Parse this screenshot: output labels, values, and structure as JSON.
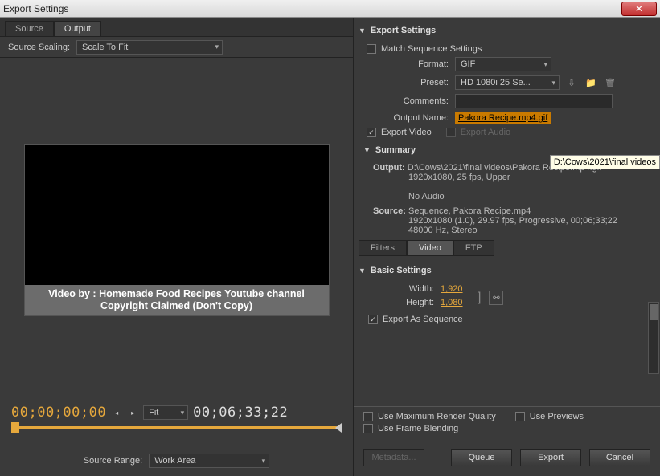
{
  "window": {
    "title": "Export Settings"
  },
  "left": {
    "tabs": {
      "source": "Source",
      "output": "Output",
      "active": "output"
    },
    "scaling": {
      "label": "Source Scaling:",
      "value": "Scale To Fit"
    },
    "watermark": {
      "line1": "Video by : Homemade Food Recipes Youtube channel",
      "line2": "Copyright Claimed (Don't Copy)"
    },
    "time": {
      "current": "00;00;00;00",
      "duration": "00;06;33;22",
      "fit": "Fit"
    },
    "range": {
      "label": "Source Range:",
      "value": "Work Area"
    }
  },
  "export": {
    "header": "Export Settings",
    "match": {
      "label": "Match Sequence Settings",
      "checked": false
    },
    "format": {
      "label": "Format:",
      "value": "GIF"
    },
    "preset": {
      "label": "Preset:",
      "value": "HD 1080i 25 Se..."
    },
    "comments": {
      "label": "Comments:"
    },
    "outputname": {
      "label": "Output Name:",
      "value": "Pakora Recipe.mp4.gif"
    },
    "expvideo": {
      "label": "Export Video",
      "checked": true
    },
    "expaudio": {
      "label": "Export Audio",
      "checked": false
    },
    "summary": {
      "header": "Summary",
      "output_label": "Output:",
      "output_line1": "D:\\Cows\\2021\\final videos\\Pakora Recipe.mp4.gif",
      "output_line2": "1920x1080, 25 fps, Upper",
      "output_line3": "No Audio",
      "source_label": "Source:",
      "source_line1": "Sequence, Pakora Recipe.mp4",
      "source_line2": "1920x1080 (1.0), 29.97 fps, Progressive, 00;06;33;22",
      "source_line3": "48000 Hz, Stereo"
    }
  },
  "tabs2": {
    "filters": "Filters",
    "video": "Video",
    "ftp": "FTP",
    "active": "video"
  },
  "basic": {
    "header": "Basic Settings",
    "width_label": "Width:",
    "width": "1,920",
    "height_label": "Height:",
    "height": "1,080",
    "seq": {
      "label": "Export As Sequence",
      "checked": true
    }
  },
  "options": {
    "maxq": {
      "label": "Use Maximum Render Quality",
      "checked": false
    },
    "previews": {
      "label": "Use Previews",
      "checked": false
    },
    "blend": {
      "label": "Use Frame Blending",
      "checked": false
    }
  },
  "buttons": {
    "metadata": "Metadata...",
    "queue": "Queue",
    "export": "Export",
    "cancel": "Cancel"
  },
  "tooltip": "D:\\Cows\\2021\\final videos"
}
